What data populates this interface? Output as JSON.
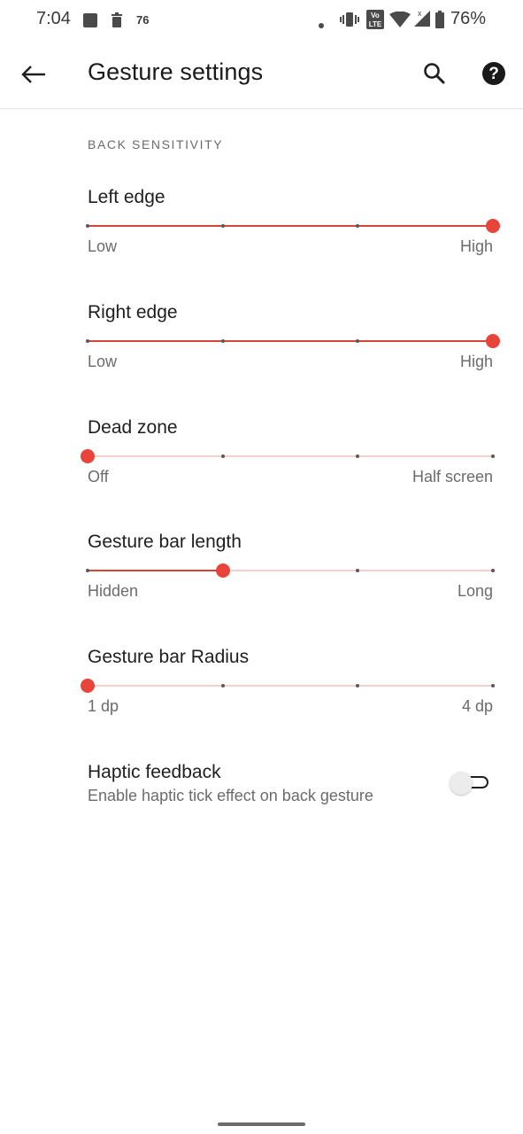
{
  "status_bar": {
    "time": "7:04",
    "notification_count": "76",
    "battery_percent": "76%",
    "icons": [
      "photo-icon",
      "delete-icon",
      "dot-icon",
      "vibrate-icon",
      "volte-icon",
      "wifi-icon",
      "signal-icon",
      "battery-icon"
    ]
  },
  "app_bar": {
    "title": "Gesture settings",
    "icons": [
      "back-arrow-icon",
      "search-icon",
      "help-icon"
    ]
  },
  "section_header": "BACK SENSITIVITY",
  "settings": [
    {
      "title": "Left edge",
      "min_label": "Low",
      "max_label": "High",
      "steps": 4,
      "value_step": 3
    },
    {
      "title": "Right edge",
      "min_label": "Low",
      "max_label": "High",
      "steps": 4,
      "value_step": 3
    },
    {
      "title": "Dead zone",
      "min_label": "Off",
      "max_label": "Half screen",
      "steps": 4,
      "value_step": 0
    },
    {
      "title": "Gesture bar length",
      "min_label": "Hidden",
      "max_label": "Long",
      "steps": 4,
      "value_step": 1
    },
    {
      "title": "Gesture bar Radius",
      "min_label": "1 dp",
      "max_label": "4 dp",
      "steps": 4,
      "value_step": 0
    }
  ],
  "haptic": {
    "title": "Haptic feedback",
    "subtitle": "Enable haptic tick effect on back gesture",
    "enabled": false
  },
  "colors": {
    "accent": "#e9443a",
    "track_active": "#d84335",
    "track_inactive": "#f6d0cd",
    "text_primary": "#1f1f1f",
    "text_secondary": "#6b6b6b"
  }
}
